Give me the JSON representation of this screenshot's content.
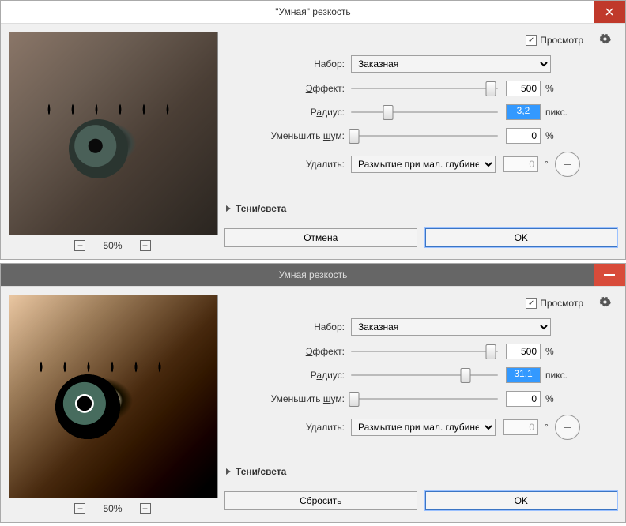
{
  "dialogs": [
    {
      "title": "\"Умная\" резкость",
      "preview_zoom": "50%",
      "preview_check_label": "Просмотр",
      "set_label": "Набор:",
      "set_value": "Заказная",
      "amount_label": "Эффект:",
      "amount_value": "500",
      "amount_unit": "%",
      "amount_slider_pct": 95,
      "radius_label": "Радиус:",
      "radius_value": "3,2",
      "radius_unit": "пикс.",
      "radius_slider_pct": 25,
      "noise_label": "Уменьшить шум:",
      "noise_value": "0",
      "noise_unit": "%",
      "noise_slider_pct": 2,
      "remove_label": "Удалить:",
      "remove_value": "Размытие при мал. глубине",
      "angle_value": "0",
      "expander_label": "Тени/света",
      "cancel_label": "Отмена",
      "ok_label": "OK"
    },
    {
      "title": "Умная  резкость",
      "preview_zoom": "50%",
      "preview_check_label": "Просмотр",
      "set_label": "Набор:",
      "set_value": "Заказная",
      "amount_label": "Эффект:",
      "amount_value": "500",
      "amount_unit": "%",
      "amount_slider_pct": 95,
      "radius_label": "Радиус:",
      "radius_value": "31,1",
      "radius_unit": "пикс.",
      "radius_slider_pct": 78,
      "noise_label": "Уменьшить шум:",
      "noise_value": "0",
      "noise_unit": "%",
      "noise_slider_pct": 2,
      "remove_label": "Удалить:",
      "remove_value": "Размытие при мал. глубине",
      "angle_value": "0",
      "expander_label": "Тени/света",
      "cancel_label": "Сбросить",
      "ok_label": "OK"
    }
  ]
}
